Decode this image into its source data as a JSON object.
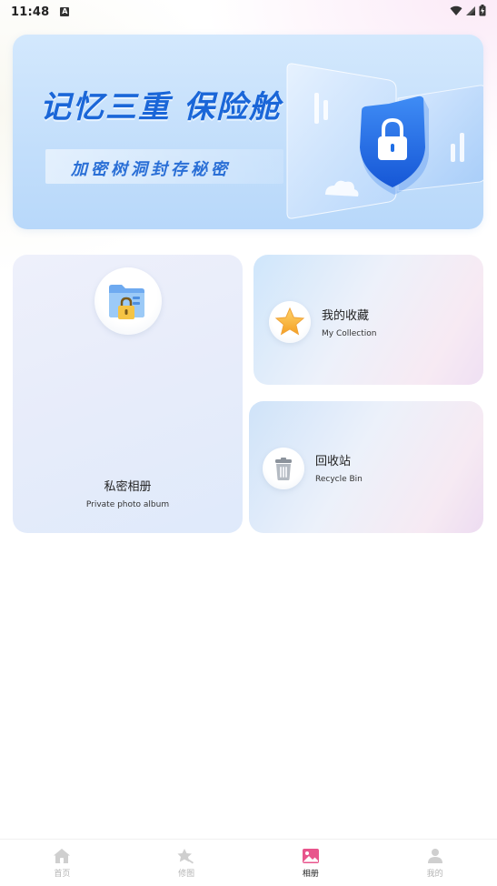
{
  "status_bar": {
    "time": "11:48",
    "notification_icon": "a-letter-icon",
    "wifi_icon": "wifi-icon",
    "signal_icon": "signal-icon",
    "battery_icon": "battery-icon"
  },
  "banner": {
    "title": "记忆三重 保险舱",
    "subtitle": "加密树洞封存秘密",
    "icon": "shield-lock-icon"
  },
  "cards": {
    "private_album": {
      "title": "私密相册",
      "subtitle": "Private photo album",
      "icon": "folder-lock-icon"
    },
    "collection": {
      "title": "我的收藏",
      "subtitle": "My Collection",
      "icon": "star-icon"
    },
    "recycle": {
      "title": "回收站",
      "subtitle": "Recycle Bin",
      "icon": "trash-bin-icon"
    }
  },
  "bottom_nav": {
    "items": [
      {
        "label": "首页",
        "icon": "home-icon",
        "active": false
      },
      {
        "label": "修图",
        "icon": "edit-star-icon",
        "active": false
      },
      {
        "label": "相册",
        "icon": "album-icon",
        "active": true
      },
      {
        "label": "我的",
        "icon": "profile-icon",
        "active": false
      }
    ]
  },
  "colors": {
    "accent_blue": "#1a66d8",
    "active_tab": "#e8558c",
    "inactive_tab": "#cfcfcf"
  }
}
